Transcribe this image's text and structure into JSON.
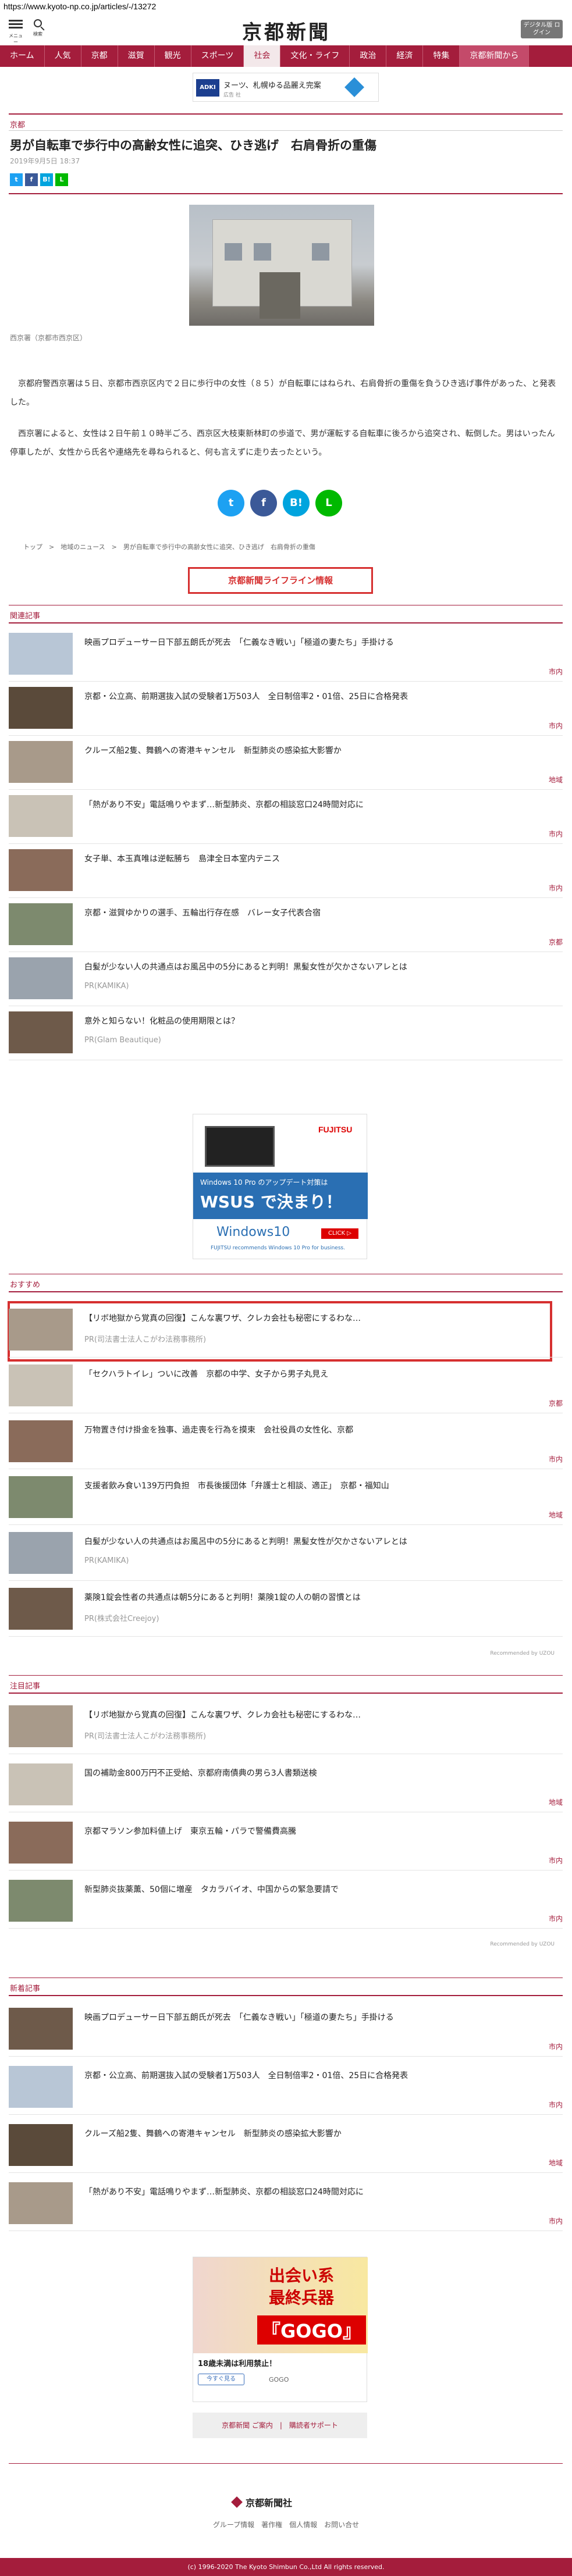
{
  "url": "https://www.kyoto-np.co.jp/articles/-/13272",
  "header": {
    "menu_label": "メニュー",
    "search_label": "検索",
    "logo": "京都新聞",
    "digital_btn": "デジタル版 ログイン"
  },
  "nav": [
    "ホーム",
    "人気",
    "京都",
    "滋賀",
    "観光",
    "スポーツ",
    "社会",
    "文化・ライフ",
    "政治",
    "経済",
    "特集",
    "京都新聞から"
  ],
  "nav_active": "社会",
  "ad_top": {
    "logo": "ADKI",
    "title": "ヌーツ、札幌ゆる品麗え完案",
    "sub": "広告 社"
  },
  "article": {
    "section": "京都",
    "title": "男が自転車で歩行中の高齢女性に追突、ひき逃げ　右肩骨折の重傷",
    "date": "2019年9月5日 18:37",
    "caption": "西京署（京都市西京区）",
    "para1": "　京都府警西京署は５日、京都市西京区内で２日に歩行中の女性（８５）が自転車にはねられ、右肩骨折の重傷を負うひき逃げ事件があった、と発表した。",
    "para2": "　西京署によると、女性は２日午前１０時半ごろ、西京区大枝東新林町の歩道で、男が運転する自転車に後ろから追突され、転倒した。男はいったん停車したが、女性から氏名や連絡先を尋ねられると、何も言えずに走り去ったという。"
  },
  "share_small": [
    "t",
    "f",
    "B!",
    "L"
  ],
  "share_big": [
    "t",
    "f",
    "B!",
    "L"
  ],
  "breadcrumb": "トップ　>　地域のニュース　>　男が自転車で歩行中の高齢女性に追突、ひき逃げ　右肩骨折の重傷",
  "lifeline": "京都新聞ライフライン情報",
  "related": {
    "label": "関連記事",
    "items": [
      {
        "title": "映画プロデューサー日下部五朗氏が死去　「仁義なき戦い」「極道の妻たち」手掛ける",
        "tag": "市内"
      },
      {
        "title": "京都・公立高、前期選抜入試の受験者1万503人　全日制倍率2・01倍、25日に合格発表",
        "tag": "市内"
      },
      {
        "title": "クルーズ船2隻、舞鶴への寄港キャンセル　新型肺炎の感染拡大影響か",
        "tag": "地域"
      },
      {
        "title": "「熱があり不安」電話鳴りやまず…新型肺炎、京都の相談窓口24時間対応に",
        "tag": "市内"
      },
      {
        "title": "女子単、本玉真唯は逆転勝ち　島津全日本室内テニス",
        "tag": "市内"
      },
      {
        "title": "京都・滋賀ゆかりの選手、五輪出行存在感　バレー女子代表合宿",
        "tag": "京都"
      },
      {
        "title": "白髪が少ない人の共通点はお風呂中の5分にあると判明！黒髪女性が欠かさないアレとは",
        "sub": "PR(KAMIKA)"
      },
      {
        "title": "意外と知らない！化粧品の使用期限とは？",
        "sub": "PR(Glam Beautique)"
      }
    ]
  },
  "ad_mid": {
    "brand": "FUJITSU",
    "line1": "Windows 10 Pro のアップデート対策は",
    "big": "WSUS で決まり！",
    "win": "Windows10",
    "click": "CLICK ▷",
    "foot": "FUJITSU recommends Windows 10 Pro for business."
  },
  "recommend": {
    "label": "おすすめ",
    "items": [
      {
        "title": "【リボ地獄から覚真の回復】こんな裏ワザ、クレカ会社も秘密にするわな…",
        "sub": "PR(司法書士法人こがわ法務事務所)"
      },
      {
        "title": "「セクハラトイレ」ついに改善　京都の中学、女子から男子丸見え",
        "tag": "京都"
      },
      {
        "title": "万物置き付け掛金を独事、過走喪を行為を摸束　会社役員の女性化、京都",
        "tag": "市内"
      },
      {
        "title": "支援者飲み食い139万円負担　市長後援団体「弁護士と相談、適正」　京都・福知山",
        "tag": "地域"
      },
      {
        "title": "白髪が少ない人の共通点はお風呂中の5分にあると判明！黒髪女性が欠かさないアレとは",
        "sub": "PR(KAMIKA)"
      },
      {
        "title": "薬険1錠会性者の共通点は朝5分にあると判明！薬険1錠の人の朝の習慣とは",
        "sub": "PR(株式会社Creejoy)"
      }
    ],
    "powered": "Recommended by UZOU"
  },
  "attention": {
    "label": "注目記事",
    "items": [
      {
        "title": "【リボ地獄から覚真の回復】こんな裏ワザ、クレカ会社も秘密にするわな…",
        "sub": "PR(司法書士法人こがわ法務事務所)"
      },
      {
        "title": "国の補助金800万円不正受給、京都府南債典の男ら3人書類送検",
        "tag": "地域"
      },
      {
        "title": "京都マラソン参加料値上げ　東京五輪・パラで警備費高騰",
        "tag": "市内"
      },
      {
        "title": "新型肺炎抜薬薫、50個に増産　タカラバイオ、中国からの緊急要請で",
        "tag": "市内"
      }
    ],
    "powered": "Recommended by UZOU"
  },
  "latest": {
    "label": "新着記事",
    "items": [
      {
        "title": "映画プロデューサー日下部五朗氏が死去　「仁義なき戦い」「極道の妻たち」手掛ける",
        "tag": "市内"
      },
      {
        "title": "京都・公立高、前期選抜入試の受験者1万503人　全日制倍率2・01倍、25日に合格発表",
        "tag": "市内"
      },
      {
        "title": "クルーズ船2隻、舞鶴への寄港キャンセル　新型肺炎の感染拡大影響か",
        "tag": "地域"
      },
      {
        "title": "「熱があり不安」電話鳴りやまず…新型肺炎、京都の相談窓口24時間対応に",
        "tag": "市内"
      }
    ]
  },
  "ad_bottom": {
    "t1": "出会い系",
    "t2": "最終兵器",
    "t3": "『GOGO』",
    "txt": "18歳未満は利用禁止！",
    "btn": "今すぐ見る",
    "brand": "GOGO"
  },
  "footer": {
    "links": "京都新聞 ご案内　|　購読者サポート",
    "logo": "京都新聞社",
    "nav": "グループ情報　著作権　個人情報　お問い合せ",
    "copyright": "(c) 1996-2020 The Kyoto Shimbun Co.,Ltd All rights reserved."
  }
}
